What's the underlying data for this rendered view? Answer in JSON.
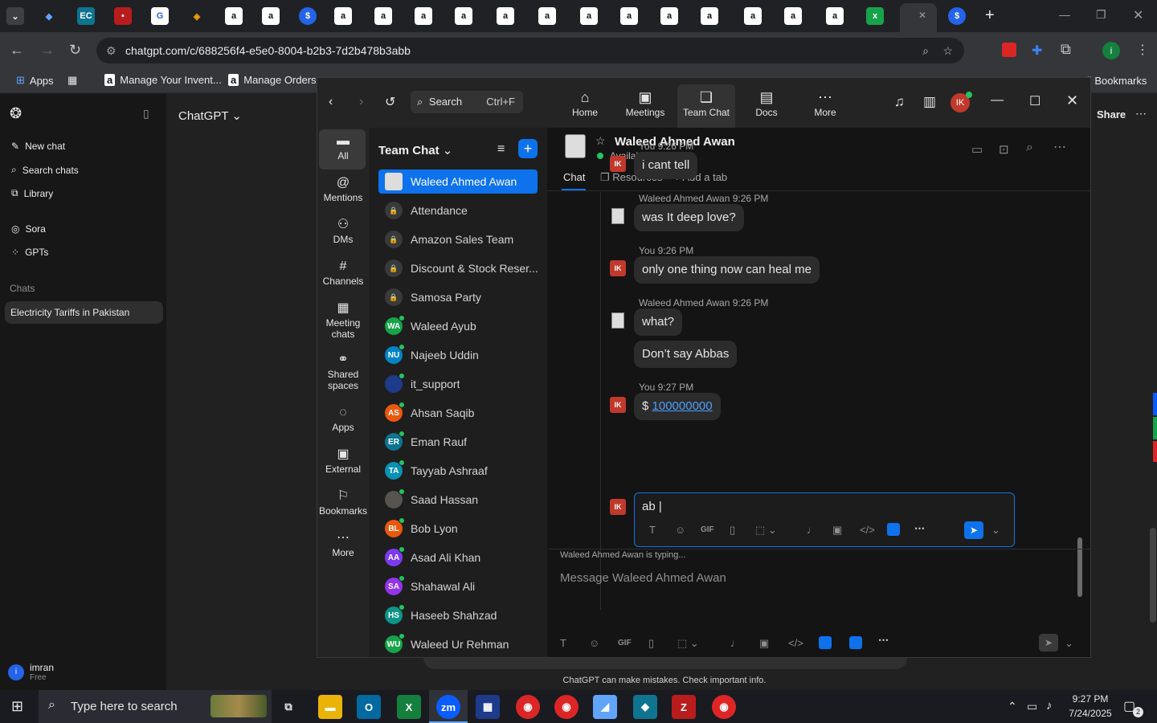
{
  "browser": {
    "url": "chatgpt.com/c/688256f4-e5e0-8004-b2b3-7d2b478b3abb",
    "bookmarks": [
      {
        "label": "Apps"
      },
      {
        "label": "Manage Your Invent..."
      },
      {
        "label": "Manage Orders"
      }
    ],
    "all_bookmarks": "All Bookmarks"
  },
  "chatgpt": {
    "model": "ChatGPT ⌄",
    "nav": [
      {
        "label": "New chat"
      },
      {
        "label": "Search chats"
      },
      {
        "label": "Library"
      },
      {
        "label": "Sora"
      },
      {
        "label": "GPTs"
      }
    ],
    "chats_header": "Chats",
    "active_chat": "Electricity Tariffs in Pakistan",
    "user_name": "imran",
    "user_plan": "Free",
    "user_initial": "i",
    "share": "Share",
    "disclaimer": "ChatGPT can make mistakes. Check important info."
  },
  "zoom": {
    "search": "Search",
    "search_shortcut": "Ctrl+F",
    "top_nav": [
      {
        "label": "Home"
      },
      {
        "label": "Meetings"
      },
      {
        "label": "Team Chat"
      },
      {
        "label": "Docs"
      },
      {
        "label": "More"
      }
    ],
    "user_badge": "IK",
    "rail": [
      {
        "label": "All"
      },
      {
        "label": "Mentions"
      },
      {
        "label": "DMs"
      },
      {
        "label": "Channels"
      },
      {
        "label": "Meeting chats"
      },
      {
        "label": "Shared spaces"
      },
      {
        "label": "Apps"
      },
      {
        "label": "External"
      },
      {
        "label": "Bookmarks"
      },
      {
        "label": "More"
      }
    ],
    "list_title": "Team Chat",
    "channels": [
      {
        "name": "Waleed Ahmed Awan",
        "type": "photo",
        "active": true
      },
      {
        "name": "Attendance",
        "type": "lock"
      },
      {
        "name": "Amazon Sales Team",
        "type": "lock"
      },
      {
        "name": "Discount & Stock Reser...",
        "type": "lock"
      },
      {
        "name": "Samosa Party",
        "type": "lock"
      },
      {
        "name": "Waleed Ayub",
        "initials": "WA",
        "color": "#16a34a"
      },
      {
        "name": "Najeeb Uddin",
        "initials": "NU",
        "color": "#0284c7"
      },
      {
        "name": "it_support",
        "initials": "",
        "color": "#1e3a8a"
      },
      {
        "name": "Ahsan Saqib",
        "initials": "AS",
        "color": "#ea580c"
      },
      {
        "name": "Eman Rauf",
        "initials": "ER",
        "color": "#0e7490"
      },
      {
        "name": "Tayyab Ashraaf",
        "initials": "TA",
        "color": "#0891b2"
      },
      {
        "name": "Saad Hassan",
        "initials": "",
        "color": "#57534e"
      },
      {
        "name": "Bob Lyon",
        "initials": "BL",
        "color": "#ea580c"
      },
      {
        "name": "Asad Ali Khan",
        "initials": "AA",
        "color": "#7c3aed"
      },
      {
        "name": "Shahawal Ali",
        "initials": "SA",
        "color": "#9333ea"
      },
      {
        "name": "Haseeb Shahzad",
        "initials": "HS",
        "color": "#0d9488"
      },
      {
        "name": "Waleed Ur Rehman",
        "initials": "WU",
        "color": "#16a34a"
      }
    ],
    "contact": {
      "name": "Waleed Ahmed Awan",
      "status": "Available"
    },
    "tabs": [
      {
        "label": "Chat"
      },
      {
        "label": "Resources"
      },
      {
        "label": "Add a tab"
      }
    ],
    "messages": [
      {
        "header": "You 9:26 PM",
        "text": "i cant tell",
        "me": true
      },
      {
        "header": "Waleed Ahmed Awan 9:26 PM",
        "text": "was It deep love?",
        "me": false
      },
      {
        "header": "You 9:26 PM",
        "text": "only one thing now can heal me",
        "me": true
      },
      {
        "header": "Waleed Ahmed Awan 9:26 PM",
        "text": "what?",
        "me": false
      },
      {
        "header": "",
        "text": "Don’t say Abbas",
        "me": false
      },
      {
        "header": "You 9:27 PM",
        "text": "$ ",
        "link": "100000000",
        "me": true
      }
    ],
    "me_badge": "IK",
    "compose_value": "ab",
    "typing": "Waleed Ahmed Awan  is typing...",
    "message_placeholder": "Message Waleed Ahmed Awan",
    "gif": "GIF"
  },
  "taskbar": {
    "search_placeholder": "Type here to search",
    "time": "9:27 PM",
    "date": "7/24/2025",
    "notif_count": "2"
  },
  "colors": {
    "zoom_blue": "#0b5cff",
    "active_item": "#0e72ed",
    "ik_red": "#c0392b"
  }
}
